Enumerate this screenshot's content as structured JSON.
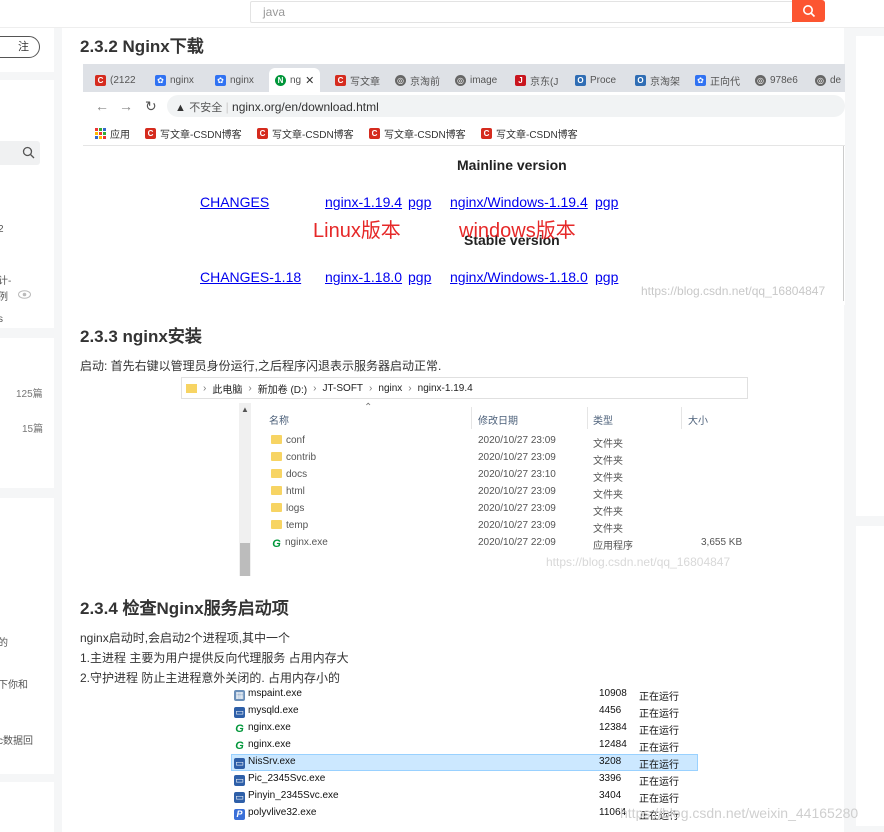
{
  "topbar": {
    "search_placeholder": "java"
  },
  "sidebar": {
    "follow_label": "注",
    "fragments": [
      "2",
      "计-",
      "s",
      "例",
      "的",
      "下你和",
      "c数据回"
    ],
    "counts": [
      "125篇",
      "15篇"
    ]
  },
  "article": {
    "h1": "2.3.2 Nginx下载",
    "h2": "2.3.3 nginx安装",
    "p1": "启动: 首先右键以管理员身份运行,之后程序闪退表示服务器启动正常.",
    "h3": "2.3.4 检查Nginx服务启动项",
    "p2": "nginx启动时,会启动2个进程项,其中一个",
    "p3": "1.主进程 主要为用户提供反向代理服务 占用内存大",
    "p4": "2.守护进程 防止主进程意外关闭的. 占用内存小的"
  },
  "browser": {
    "tabs": [
      "(2122",
      "nginx",
      "nginx",
      "ng",
      "写文章",
      "京淘前",
      "image",
      "京东(J",
      "Proce",
      "京淘架",
      "正向代",
      "978e6",
      "de"
    ],
    "not_secure": "不安全",
    "url": "nginx.org/en/download.html",
    "apps_label": "应用",
    "bookmarks": [
      "写文章-CSDN博客",
      "写文章-CSDN博客",
      "写文章-CSDN博客",
      "写文章-CSDN博客"
    ],
    "mainline_heading": "Mainline version",
    "stable_heading": "Stable version",
    "changes": "CHANGES",
    "nginx_1194": "nginx-1.19.4",
    "pgp": "pgp",
    "win_1194": "nginx/Windows-1.19.4",
    "changes_118": "CHANGES-1.18",
    "nginx_1180": "nginx-1.18.0",
    "win_1180": "nginx/Windows-1.18.0",
    "linux_label": "Linux版本",
    "windows_label": "windows版本",
    "watermark": "https://blog.csdn.net/qq_16804847"
  },
  "explorer": {
    "breadcrumb": [
      "此电脑",
      "新加卷 (D:)",
      "JT-SOFT",
      "nginx",
      "nginx-1.19.4"
    ],
    "columns": [
      "名称",
      "修改日期",
      "类型",
      "大小"
    ],
    "rows": [
      {
        "name": "conf",
        "date": "2020/10/27 23:09",
        "type": "文件夹",
        "size": ""
      },
      {
        "name": "contrib",
        "date": "2020/10/27 23:09",
        "type": "文件夹",
        "size": ""
      },
      {
        "name": "docs",
        "date": "2020/10/27 23:10",
        "type": "文件夹",
        "size": ""
      },
      {
        "name": "html",
        "date": "2020/10/27 23:09",
        "type": "文件夹",
        "size": ""
      },
      {
        "name": "logs",
        "date": "2020/10/27 23:09",
        "type": "文件夹",
        "size": ""
      },
      {
        "name": "temp",
        "date": "2020/10/27 23:09",
        "type": "文件夹",
        "size": ""
      },
      {
        "name": "nginx.exe",
        "date": "2020/10/27 22:09",
        "type": "应用程序",
        "size": "3,655 KB"
      }
    ],
    "watermark": "https://blog.csdn.net/qq_16804847"
  },
  "processes": {
    "rows": [
      {
        "name": "mspaint.exe",
        "pid": "10908",
        "status": "正在运行"
      },
      {
        "name": "mysqld.exe",
        "pid": "4456",
        "status": "正在运行"
      },
      {
        "name": "nginx.exe",
        "pid": "12384",
        "status": "正在运行"
      },
      {
        "name": "nginx.exe",
        "pid": "12484",
        "status": "正在运行"
      },
      {
        "name": "NisSrv.exe",
        "pid": "3208",
        "status": "正在运行"
      },
      {
        "name": "Pic_2345Svc.exe",
        "pid": "3396",
        "status": "正在运行"
      },
      {
        "name": "Pinyin_2345Svc.exe",
        "pid": "3404",
        "status": "正在运行"
      },
      {
        "name": "polyvlive32.exe",
        "pid": "11064",
        "status": "正在运行"
      }
    ],
    "watermark": "https://blog.csdn.net/weixin_44165280"
  }
}
